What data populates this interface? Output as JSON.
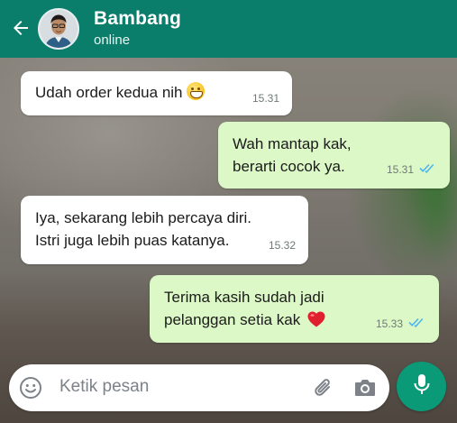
{
  "header": {
    "contact_name": "Bambang",
    "contact_status": "online",
    "color": "#0b7d6b"
  },
  "messages": [
    {
      "direction": "incoming",
      "text_lines": [
        "Udah order kedua nih"
      ],
      "emoji": "grinning-face",
      "time": "15.31"
    },
    {
      "direction": "outgoing",
      "text_lines": [
        "Wah mantap kak,",
        "berarti cocok ya."
      ],
      "time": "15.31",
      "status": "read"
    },
    {
      "direction": "incoming",
      "text_lines": [
        "Iya, sekarang lebih percaya diri.",
        "Istri juga lebih puas katanya."
      ],
      "time": "15.32"
    },
    {
      "direction": "outgoing",
      "text_lines": [
        "Terima kasih sudah jadi",
        "pelanggan setia kak"
      ],
      "emoji": "red-heart",
      "time": "15.33",
      "status": "read"
    }
  ],
  "composer": {
    "placeholder": "Ketik pesan",
    "mic_color": "#0b9a78"
  },
  "colors": {
    "incoming_bubble": "#ffffff",
    "outgoing_bubble": "#dcf8c6",
    "read_ticks": "#4fb6ec"
  }
}
